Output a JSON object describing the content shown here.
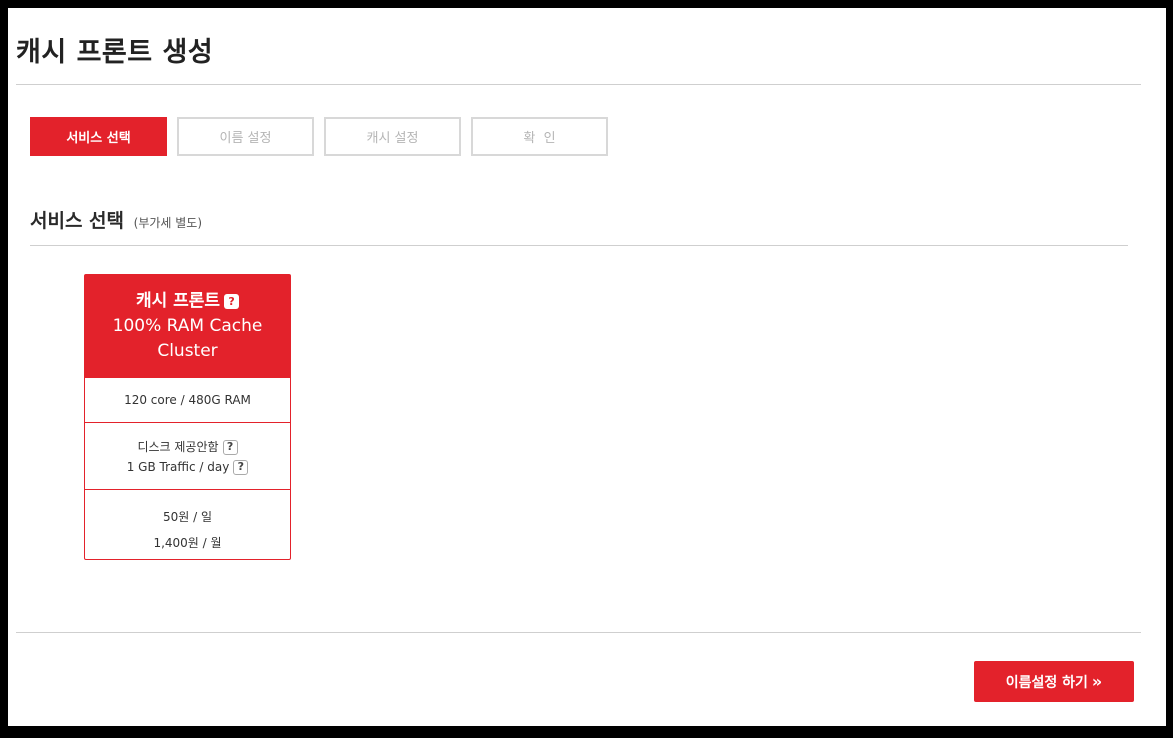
{
  "page": {
    "title": "캐시 프론트 생성"
  },
  "steps": [
    {
      "label": "서비스 선택",
      "active": true
    },
    {
      "label": "이름 설정",
      "active": false
    },
    {
      "label": "캐시 설정",
      "active": false
    },
    {
      "label": "확  인",
      "active": false
    }
  ],
  "section": {
    "title": "서비스 선택",
    "subtitle": "(부가세 별도)"
  },
  "card": {
    "name": "캐시 프론트",
    "help_icon": "question-icon",
    "desc_line1": "100% RAM Cache",
    "desc_line2": "Cluster",
    "spec": "120 core / 480G RAM",
    "disk": "디스크 제공안함",
    "traffic": "1 GB Traffic / day",
    "price_day": "50원 / 일",
    "price_month": "1,400원 / 월"
  },
  "footer": {
    "next_label": "이름설정 하기",
    "next_icon": "double-chevron-right-icon"
  },
  "colors": {
    "accent": "#e3222b",
    "inactive_border": "#d8d8d8",
    "inactive_text": "#b5b5b5"
  }
}
